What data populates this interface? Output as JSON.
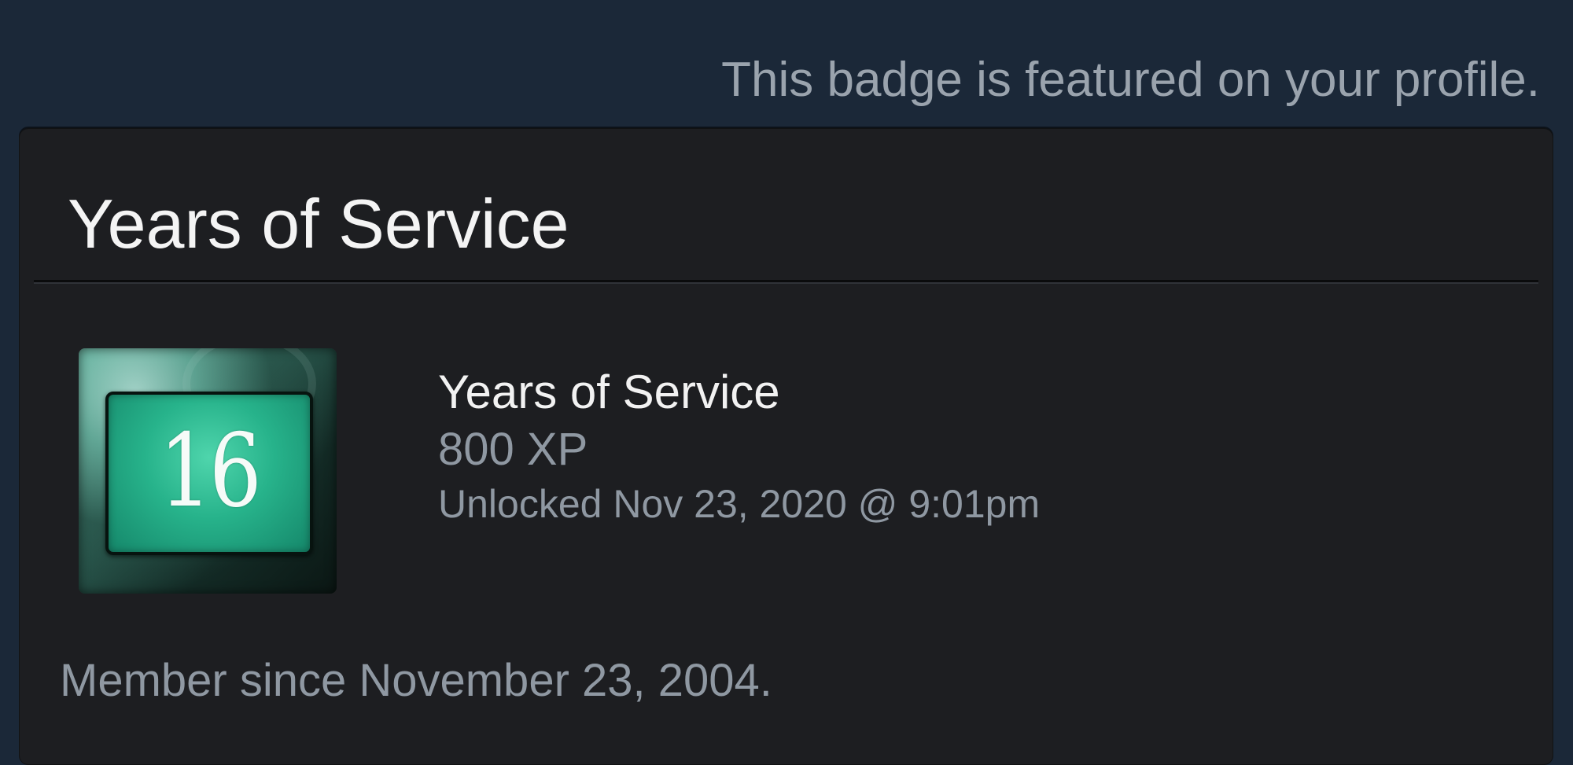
{
  "header": {
    "featured_note": "This badge is featured on your profile."
  },
  "card": {
    "title": "Years of Service",
    "badge": {
      "icon": "years-of-service-badge-icon",
      "number": "16",
      "name": "Years of Service",
      "xp": "800 XP",
      "unlocked": "Unlocked Nov 23, 2020 @ 9:01pm"
    },
    "description": "Member since November 23, 2004."
  },
  "colors": {
    "background": "#1b2838",
    "card": "#1d1e21",
    "badge_green": "#27b38b",
    "text_primary": "#f2f2f2",
    "text_secondary": "#8f98a2"
  }
}
